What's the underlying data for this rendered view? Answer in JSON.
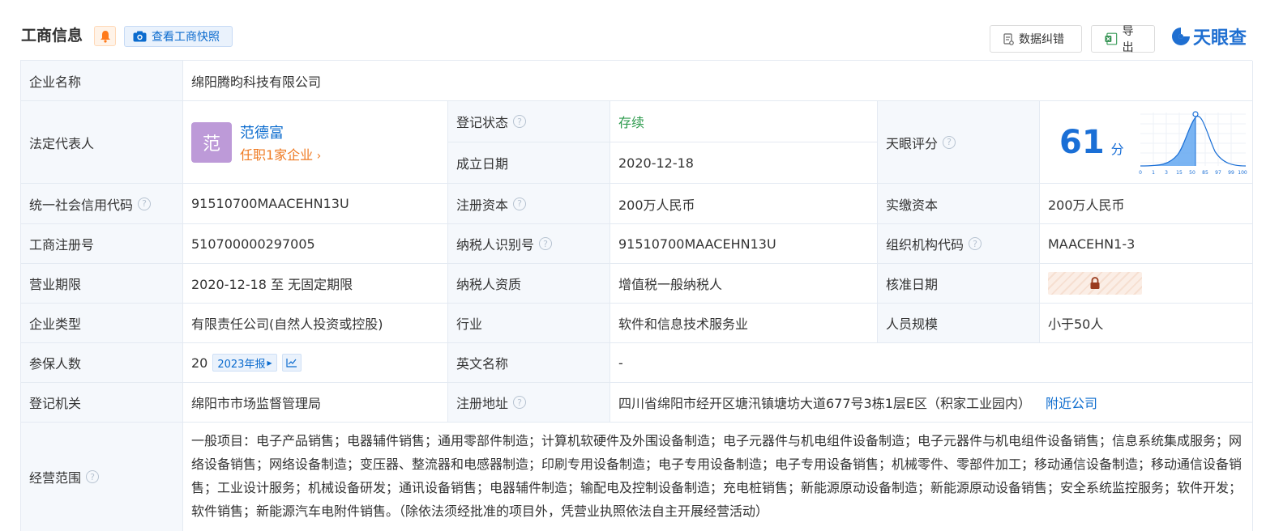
{
  "header": {
    "title": "工商信息",
    "snapshot_label": "查看工商快照",
    "correct_label": "数据纠错",
    "export_label": "导出",
    "logo_text": "天眼查"
  },
  "company": {
    "name_label": "企业名称",
    "name": "绵阳腾昀科技有限公司",
    "legal_rep_label": "法定代表人",
    "legal_rep_avatar": "范",
    "legal_rep_name": "范德富",
    "legal_rep_sub": "任职1家企业",
    "status_label": "登记状态",
    "status": "存续",
    "founded_label": "成立日期",
    "founded": "2020-12-18",
    "score_label": "天眼评分",
    "score": "61",
    "score_unit": "分",
    "score_axis": [
      "0",
      "1",
      "3",
      "15",
      "50",
      "85",
      "97",
      "99",
      "100"
    ],
    "credit_code_label": "统一社会信用代码",
    "credit_code": "91510700MAACEHN13U",
    "reg_capital_label": "注册资本",
    "reg_capital": "200万人民币",
    "paid_capital_label": "实缴资本",
    "paid_capital": "200万人民币",
    "reg_no_label": "工商注册号",
    "reg_no": "510700000297005",
    "taxpayer_id_label": "纳税人识别号",
    "taxpayer_id": "91510700MAACEHN13U",
    "org_code_label": "组织机构代码",
    "org_code": "MAACEHN1-3",
    "term_label": "营业期限",
    "term": "2020-12-18 至 无固定期限",
    "tax_qual_label": "纳税人资质",
    "tax_qual": "增值税一般纳税人",
    "approval_label": "核准日期",
    "type_label": "企业类型",
    "type": "有限责任公司(自然人投资或控股)",
    "industry_label": "行业",
    "industry": "软件和信息技术服务业",
    "staff_label": "人员规模",
    "staff": "小于50人",
    "insured_label": "参保人数",
    "insured": "20",
    "insured_report": "2023年报",
    "en_name_label": "英文名称",
    "en_name": "-",
    "authority_label": "登记机关",
    "authority": "绵阳市市场监督管理局",
    "address_label": "注册地址",
    "address": "四川省绵阳市经开区塘汛镇塘坊大道677号3栋1层E区（积家工业园内）",
    "nearby_label": "附近公司",
    "scope_label": "经营范围",
    "scope": "一般项目：电子产品销售；电器辅件销售；通用零部件制造；计算机软硬件及外围设备制造；电子元器件与机电组件设备制造；电子元器件与机电组件设备销售；信息系统集成服务；网络设备销售；网络设备制造；变压器、整流器和电感器制造；印刷专用设备制造；电子专用设备制造；电子专用设备销售；机械零件、零部件加工；移动通信设备制造；移动通信设备销售；工业设计服务；机械设备研发；通讯设备销售；电器辅件制造；输配电及控制设备制造；充电桩销售；新能源原动设备制造；新能源原动设备销售；安全系统监控服务；软件开发；软件销售；新能源汽车电附件销售。（除依法须经批准的项目外，凭营业执照依法自主开展经营活动）"
  },
  "colors": {
    "accent": "#0b6bce",
    "status_green": "#2e9b4e",
    "orange": "#ef7a22",
    "label_bg": "#f5f8fc"
  },
  "icons": {
    "bell": "bell-icon",
    "camera": "camera-icon",
    "doc": "document-icon",
    "excel": "excel-icon",
    "question": "question-icon",
    "lock": "lock-icon",
    "trend": "trend-chart-icon"
  }
}
